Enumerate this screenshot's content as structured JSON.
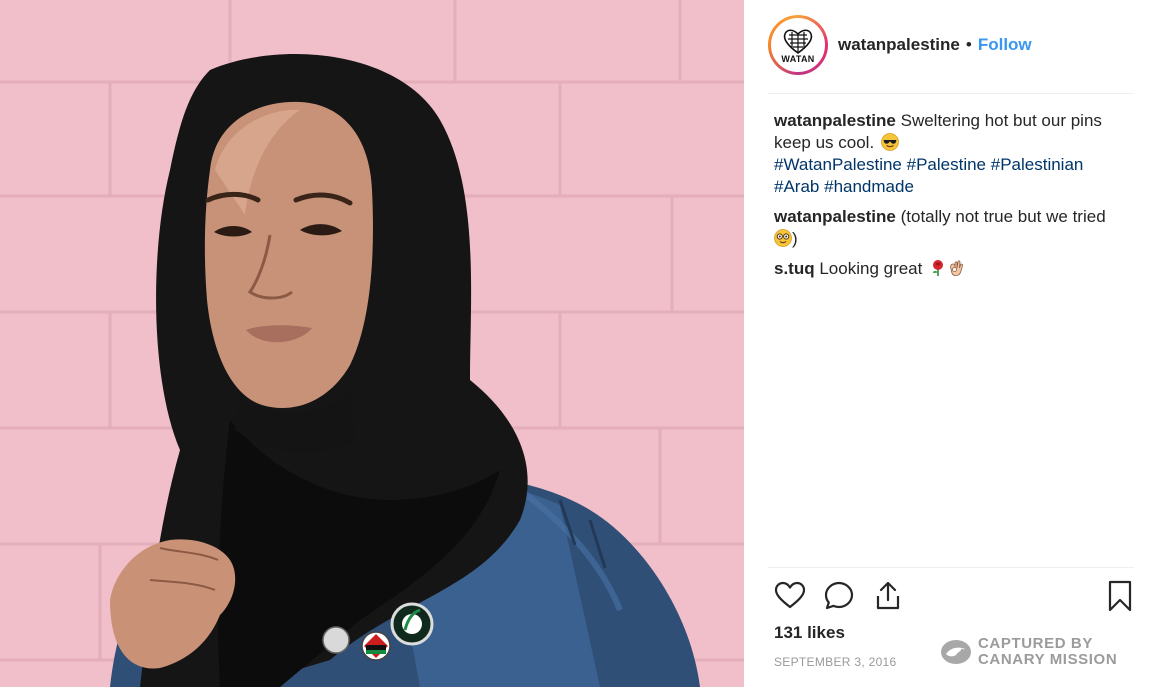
{
  "post": {
    "image_alt": "Woman in black hijab and denim jacket wearing pins against pink brick wall",
    "header": {
      "avatar_text": "WATAN",
      "username": "watanpalestine",
      "separator": "•",
      "follow_label": "Follow"
    },
    "comments": [
      {
        "user": "watanpalestine",
        "text": "Sweltering hot but our pins keep us cool.",
        "emoji": "sunglasses-emoji",
        "hashtags": [
          "#WatanPalestine",
          "#Palestine",
          "#Palestinian",
          "#Arab",
          "#handmade"
        ]
      },
      {
        "user": "watanpalestine",
        "text_before_emoji": "(totally not true but we tried",
        "emoji": "nerd-face-emoji",
        "text_after_emoji": ")"
      },
      {
        "user": "s.tuq",
        "text": "Looking great",
        "emojis": [
          "rose-emoji",
          "ok-hand-emoji"
        ]
      }
    ],
    "actions": {
      "like": "heart-icon",
      "comment": "comment-icon",
      "share": "share-icon",
      "save": "bookmark-icon"
    },
    "likes_text": "131 likes",
    "date_text": "SEPTEMBER 3, 2016"
  },
  "watermark": {
    "line1": "CAPTURED BY",
    "line2": "CANARY MISSION"
  },
  "colors": {
    "wall_pink": "#f0bcc7",
    "hashtag_blue": "#003569",
    "follow_blue": "#3897f0",
    "text_dark": "#262626",
    "date_grey": "#999999"
  }
}
